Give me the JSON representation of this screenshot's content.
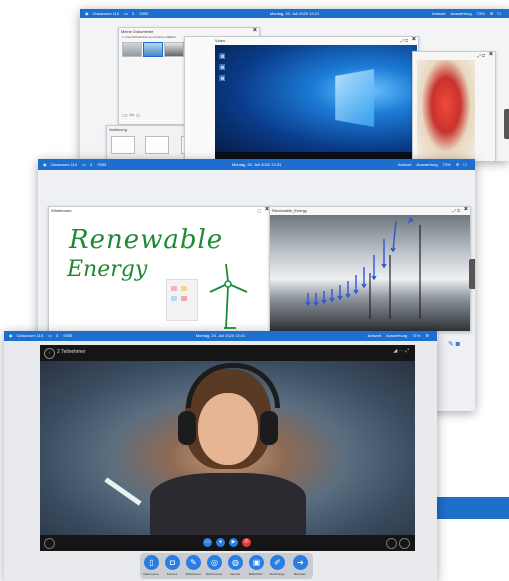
{
  "back_window": {
    "topbar": {
      "left": "Classroom 110",
      "left_count": "3",
      "left_code": "9393",
      "date": "Montag, 20. Juli 2020 13:21",
      "answers": "Antwort",
      "auswertung": "Auswertung",
      "zoom": "73%"
    },
    "meine_dokumente": {
      "title": "Meine Dokumente",
      "path": "C:\\Users\\Public\\Documents\\Demo\\Bilder"
    },
    "list_items": [
      "00:00",
      "Datenbank",
      "Datenb..."
    ],
    "vorlesung_title": "Vorlesung",
    "video_title": "Video",
    "side_tab": "Screenshots"
  },
  "middle_window": {
    "topbar": {
      "left": "Classroom 110",
      "left_count": "3",
      "left_code": "9393",
      "date": "Montag, 20. Juli 2020 13:31",
      "answers": "Antwort",
      "auswertung": "Auswertung",
      "zoom": "73%"
    },
    "whiteboard": {
      "title": "Whiteboard",
      "line1": "Renewable",
      "line2": "Energy"
    },
    "image_panel": {
      "title": "Renewable_Energy"
    }
  },
  "front_window": {
    "topbar": {
      "left": "Classroom 110",
      "left_count": "3",
      "left_code": "9393",
      "date": "Montag, 20. Juli 2020 13:41",
      "answers": "Antwort",
      "auswertung": "Auswertung",
      "zoom": "71%"
    },
    "video_call": {
      "participants": "2 Teilnehmer"
    },
    "dock": [
      {
        "icon": "file-icon",
        "label": "Dokumente"
      },
      {
        "icon": "camera-icon",
        "label": "Kamera"
      },
      {
        "icon": "pen-icon",
        "label": "Whiteboard"
      },
      {
        "icon": "web-icon",
        "label": "Webbrowser"
      },
      {
        "icon": "globe-icon",
        "label": "Internet"
      },
      {
        "icon": "screenshot-icon",
        "label": "Bildschirm"
      },
      {
        "icon": "tools-icon",
        "label": "Werkzeuge"
      },
      {
        "icon": "logout-icon",
        "label": "Beenden"
      }
    ]
  },
  "colors": {
    "accent": "#1c6fcf",
    "blue_bar": "#1e6fc9"
  }
}
